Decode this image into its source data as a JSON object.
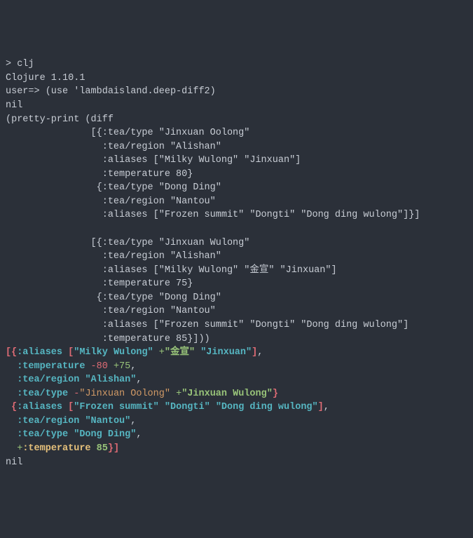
{
  "terminal": {
    "prompt_line": "> clj",
    "version_line": "Clojure 1.10.1",
    "repl_use_line": "user=> (use 'lambdaisland.deep-diff2)",
    "nil1": "nil",
    "call_open": "(pretty-print (diff",
    "arg1_l1": "               [{:tea/type \"Jinxuan Oolong\"",
    "arg1_l2": "                 :tea/region \"Alishan\"",
    "arg1_l3": "                 :aliases [\"Milky Wulong\" \"Jinxuan\"]",
    "arg1_l4": "                 :temperature 80}",
    "arg1_l5": "                {:tea/type \"Dong Ding\"",
    "arg1_l6": "                 :tea/region \"Nantou\"",
    "arg1_l7": "                 :aliases [\"Frozen summit\" \"Dongti\" \"Dong ding wulong\"]}]",
    "blank": "",
    "arg2_l1": "               [{:tea/type \"Jinxuan Wulong\"",
    "arg2_l2": "                 :tea/region \"Alishan\"",
    "arg2_l3": "                 :aliases [\"Milky Wulong\" \"金宣\" \"Jinxuan\"]",
    "arg2_l4": "                 :temperature 75}",
    "arg2_l5": "                {:tea/type \"Dong Ding\"",
    "arg2_l6": "                 :tea/region \"Nantou\"",
    "arg2_l7": "                 :aliases [\"Frozen summit\" \"Dongti\" \"Dong ding wulong\"]",
    "arg2_l8": "                 :temperature 85}]))",
    "nil2": "nil"
  },
  "diff": {
    "l1": {
      "open": "[{",
      "k1": ":aliases",
      "sp1": " ",
      "br_open": "[",
      "v1": "\"Milky Wulong\"",
      "sp2": " ",
      "plus1": "+",
      "v2": "\"金宣\"",
      "sp3": " ",
      "v3": "\"Jinxuan\"",
      "br_close": "]",
      "comma": ","
    },
    "l2": {
      "pad": "  ",
      "k": ":temperature",
      "sp1": " ",
      "minus": "-80",
      "sp2": " ",
      "plus": "+75",
      "comma": ","
    },
    "l3": {
      "pad": "  ",
      "k": ":tea/region",
      "sp": " ",
      "v": "\"Alishan\"",
      "comma": ","
    },
    "l4": {
      "pad": "  ",
      "k": ":tea/type",
      "sp1": " ",
      "minus": "-",
      "v_minus": "\"Jinxuan Oolong\"",
      "sp2": " ",
      "plus": "+",
      "v_plus": "\"Jinxuan Wulong\"",
      "close": "}"
    },
    "l5": {
      "pad": " ",
      "open": "{",
      "k": ":aliases",
      "sp": " ",
      "br_open": "[",
      "v1": "\"Frozen summit\"",
      "sp1": " ",
      "v2": "\"Dongti\"",
      "sp2": " ",
      "v3": "\"Dong ding wulong\"",
      "br_close": "]",
      "comma": ","
    },
    "l6": {
      "pad": "  ",
      "k": ":tea/region",
      "sp": " ",
      "v": "\"Nantou\"",
      "comma": ","
    },
    "l7": {
      "pad": "  ",
      "k": ":tea/type",
      "sp": " ",
      "v": "\"Dong Ding\"",
      "comma": ","
    },
    "l8": {
      "pad": "  ",
      "plus": "+",
      "k": ":temperature",
      "sp": " ",
      "v": "85",
      "close1": "}",
      "close2": "]"
    }
  }
}
